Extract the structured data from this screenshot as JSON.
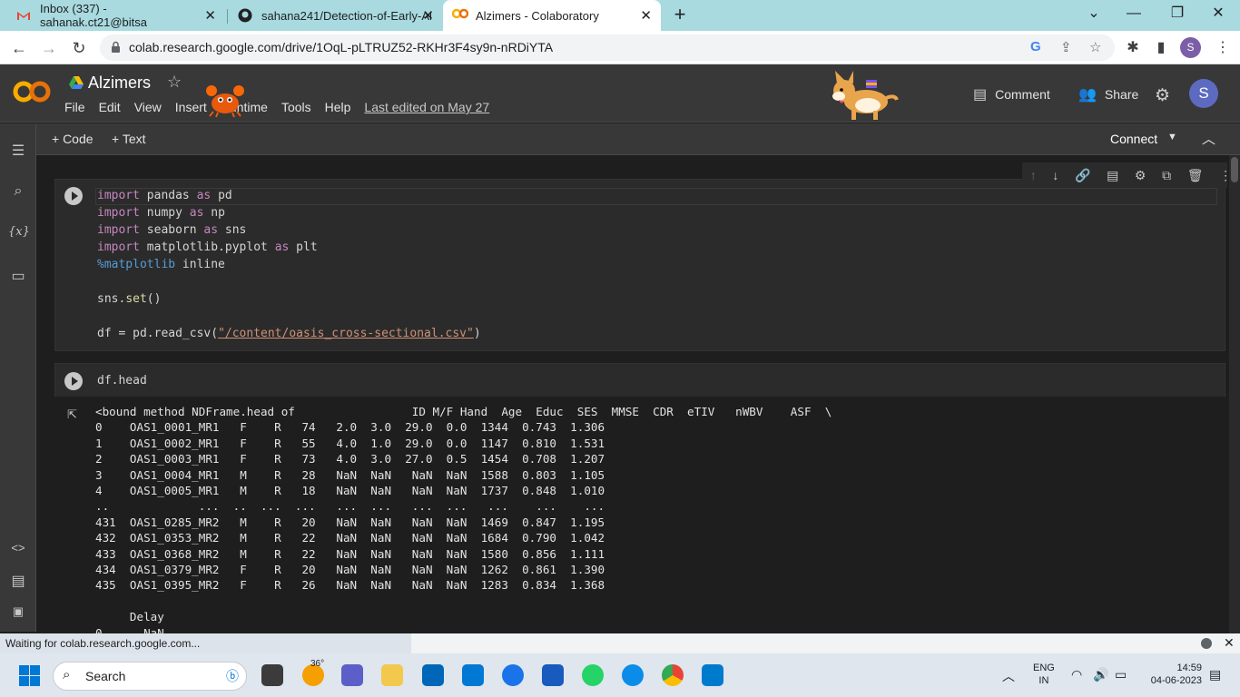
{
  "browser": {
    "tabs": [
      {
        "title": "Inbox (337) - sahanak.ct21@bitsa",
        "icon": "gmail-icon"
      },
      {
        "title": "sahana241/Detection-of-Early-Al",
        "icon": "github-icon"
      },
      {
        "title": "Alzimers - Colaboratory",
        "icon": "colab-icon"
      }
    ],
    "url": "colab.research.google.com/drive/1OqL-pLTRUZ52-RKHr3F4sy9n-nRDiYTA",
    "profile_initial": "S"
  },
  "colab": {
    "title": "Alzimers",
    "menu": [
      "File",
      "Edit",
      "View",
      "Insert",
      "Runtime",
      "Tools",
      "Help"
    ],
    "last_edited": "Last edited on May 27",
    "comment_label": "Comment",
    "share_label": "Share",
    "avatar_initial": "S",
    "add_code": "+ Code",
    "add_text": "+ Text",
    "connect_label": "Connect"
  },
  "cells": {
    "cell1": {
      "lines": [
        [
          "import",
          " pandas ",
          "as",
          " pd"
        ],
        [
          "import",
          " numpy ",
          "as",
          " np"
        ],
        [
          "import",
          " seaborn ",
          "as",
          " sns"
        ],
        [
          "import",
          " matplotlib.pyplot ",
          "as",
          " plt"
        ],
        [
          "%matplotlib",
          " inline"
        ],
        [
          "sns.",
          "set",
          "()"
        ],
        [
          "df = pd.read_csv(",
          "\"/content/oasis_cross-sectional.csv\"",
          ")"
        ]
      ]
    },
    "cell2": {
      "code": "df.head"
    },
    "output": [
      "<bound method NDFrame.head of                 ID M/F Hand  Age  Educ  SES  MMSE  CDR  eTIV   nWBV    ASF  \\",
      "0    OAS1_0001_MR1   F    R   74   2.0  3.0  29.0  0.0  1344  0.743  1.306",
      "1    OAS1_0002_MR1   F    R   55   4.0  1.0  29.0  0.0  1147  0.810  1.531",
      "2    OAS1_0003_MR1   F    R   73   4.0  3.0  27.0  0.5  1454  0.708  1.207",
      "3    OAS1_0004_MR1   M    R   28   NaN  NaN   NaN  NaN  1588  0.803  1.105",
      "4    OAS1_0005_MR1   M    R   18   NaN  NaN   NaN  NaN  1737  0.848  1.010",
      "..             ...  ..  ...  ...   ...  ...   ...  ...   ...    ...    ...",
      "431  OAS1_0285_MR2   M    R   20   NaN  NaN   NaN  NaN  1469  0.847  1.195",
      "432  OAS1_0353_MR2   M    R   22   NaN  NaN   NaN  NaN  1684  0.790  1.042",
      "433  OAS1_0368_MR2   M    R   22   NaN  NaN   NaN  NaN  1580  0.856  1.111",
      "434  OAS1_0379_MR2   F    R   20   NaN  NaN   NaN  NaN  1262  0.861  1.390",
      "435  OAS1_0395_MR2   F    R   26   NaN  NaN   NaN  NaN  1283  0.834  1.368",
      "",
      "     Delay",
      "0      NaN"
    ]
  },
  "status": {
    "text": "Waiting for colab.research.google.com..."
  },
  "taskbar": {
    "search_label": "Search",
    "weather_temp": "36°",
    "lang_1": "ENG",
    "lang_2": "IN",
    "time": "14:59",
    "date": "04-06-2023"
  }
}
